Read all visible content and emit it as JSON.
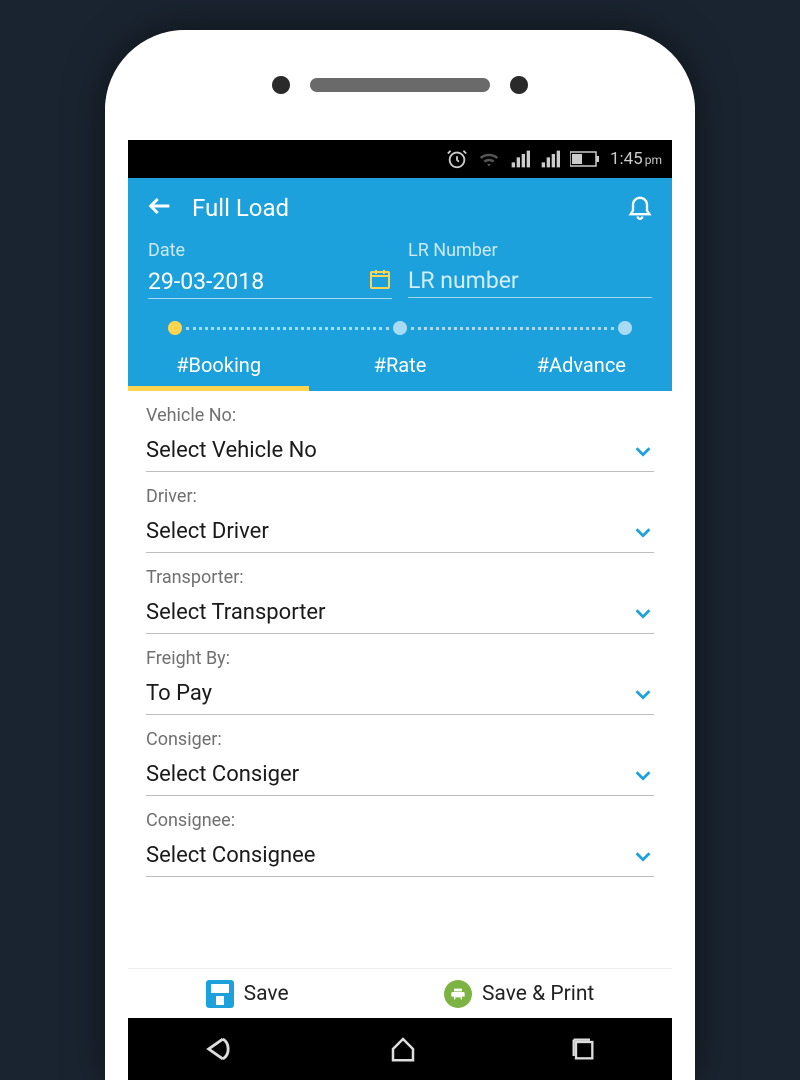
{
  "statusbar": {
    "time": "1:45",
    "ampm": "pm"
  },
  "header": {
    "title": "Full Load",
    "date_label": "Date",
    "date_value": "29-03-2018",
    "lr_label": "LR Number",
    "lr_placeholder": "LR number"
  },
  "tabs": {
    "booking": "#Booking",
    "rate": "#Rate",
    "advance": "#Advance"
  },
  "form": {
    "vehicle": {
      "label": "Vehicle No:",
      "value": "Select Vehicle No"
    },
    "driver": {
      "label": "Driver:",
      "value": "Select Driver"
    },
    "transporter": {
      "label": "Transporter:",
      "value": "Select Transporter"
    },
    "freight": {
      "label": "Freight By:",
      "value": "To Pay"
    },
    "consigner": {
      "label": "Consiger:",
      "value": "Select Consiger"
    },
    "consignee": {
      "label": "Consignee:",
      "value": "Select Consignee"
    }
  },
  "footer": {
    "save": "Save",
    "save_print": "Save & Print"
  }
}
